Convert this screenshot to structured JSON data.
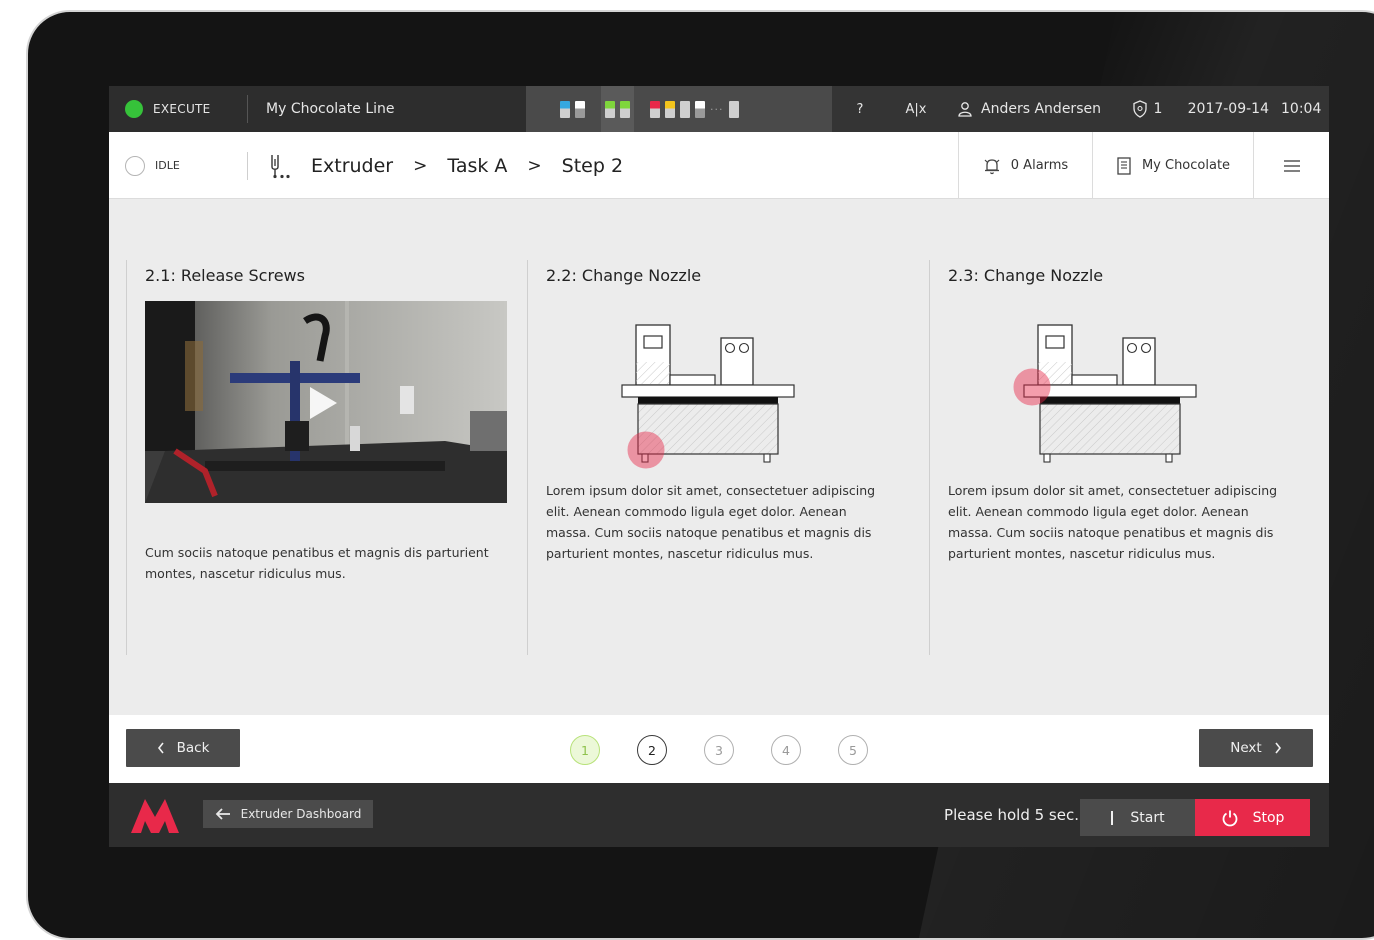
{
  "topbar": {
    "mode_label": "EXECUTE",
    "line_name": "My Chocolate Line",
    "help_label": "?",
    "language_label": "A|x",
    "user_name": "Anders Andersen",
    "notification_count": "1",
    "date": "2017-09-14",
    "time": "10:04",
    "tab_overflow": "···",
    "mode_color": "#36c23a"
  },
  "subbar": {
    "state_label": "IDLE",
    "breadcrumb": [
      "Extruder",
      "Task A",
      "Step 2"
    ],
    "breadcrumb_separator": ">",
    "alarms_label": "0 Alarms",
    "recipe_label": "My Chocolate"
  },
  "panels": [
    {
      "title": "2.1: Release Screws",
      "text": "Cum sociis natoque penatibus et magnis dis parturient montes, nascetur ridiculus mus."
    },
    {
      "title": "2.2: Change Nozzle",
      "text": "Lorem ipsum dolor sit amet, consectetuer adipiscing elit. Aenean commodo ligula eget dolor. Aenean massa. Cum sociis natoque penatibus et magnis dis parturient montes, nascetur ridiculus mus."
    },
    {
      "title": "2.3: Change Nozzle",
      "text": "Lorem ipsum dolor sit amet, consectetuer adipiscing elit. Aenean commodo ligula eget dolor. Aenean massa. Cum sociis natoque penatibus et magnis dis parturient montes, nascetur ridiculus mus."
    }
  ],
  "pager": {
    "back_label": "Back",
    "next_label": "Next",
    "steps": [
      "1",
      "2",
      "3",
      "4",
      "5"
    ],
    "current_step": 2
  },
  "bottombar": {
    "dashboard_label": "Extruder Dashboard",
    "hold_text": "Please hold 5 sec.",
    "start_label": "Start",
    "stop_label": "Stop",
    "brand_color": "#e8294a"
  },
  "icons": {
    "mode": "status-dot-icon",
    "user": "user-icon",
    "shield": "shield-icon",
    "state": "idle-ring-icon",
    "breadcrumb_root": "extruder-icon",
    "alarms": "bell-icon",
    "recipe": "document-icon",
    "menu": "hamburger-icon",
    "back": "chevron-left-icon",
    "next": "chevron-right-icon",
    "dashboard": "arrow-left-icon",
    "start": "start-bar-icon",
    "stop": "power-icon",
    "video": "play-icon"
  }
}
